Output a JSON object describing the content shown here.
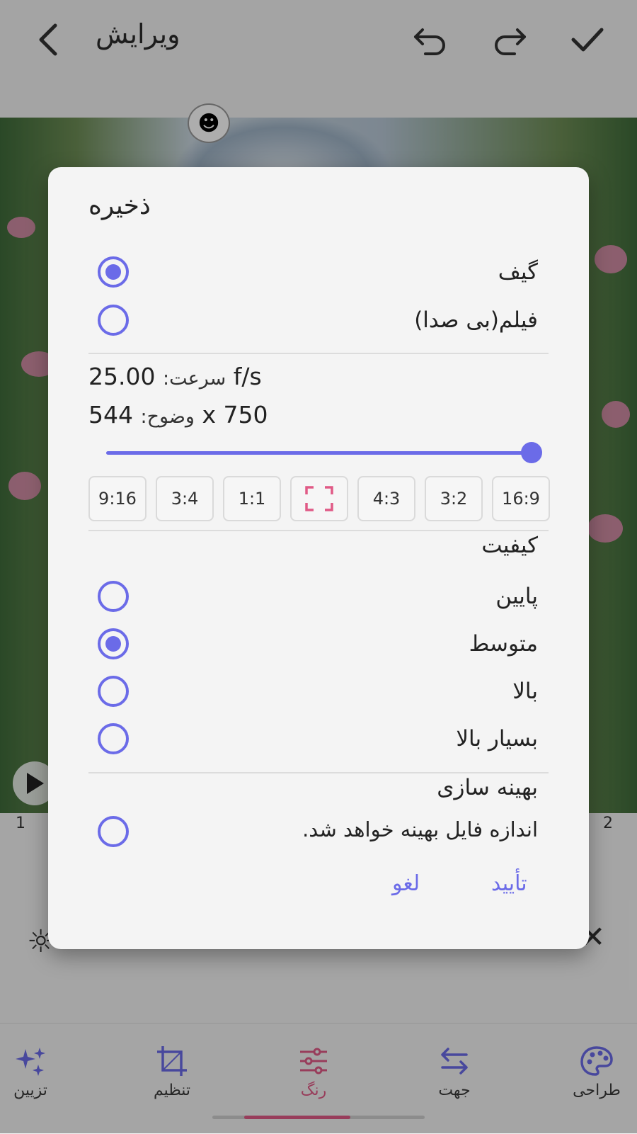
{
  "topbar": {
    "title": "ویرایش"
  },
  "photo": {
    "frame_left": "1",
    "frame_right": "2"
  },
  "bottom_nav": [
    {
      "label": "تزیین",
      "icon": "sparkles-icon"
    },
    {
      "label": "تنظیم",
      "icon": "crop-icon"
    },
    {
      "label": "رنگ",
      "icon": "sliders-icon",
      "active": true
    },
    {
      "label": "جهت",
      "icon": "swap-arrows-icon"
    },
    {
      "label": "طراحی",
      "icon": "palette-icon"
    }
  ],
  "dialog": {
    "title": "ذخیره",
    "format_options": [
      {
        "label": "گیف",
        "selected": true
      },
      {
        "label": "فیلم(بی صدا)",
        "selected": false
      }
    ],
    "speed": {
      "label": "سرعت:",
      "value": "25.00 f/s"
    },
    "resolution": {
      "label": "وضوح:",
      "value": "544 x 750"
    },
    "slider_fraction": 1.0,
    "ratios": [
      "9:16",
      "3:4",
      "1:1",
      "",
      "4:3",
      "3:2",
      "16:9"
    ],
    "quality": {
      "label": "کیفیت",
      "options": [
        {
          "label": "پایین",
          "selected": false
        },
        {
          "label": "متوسط",
          "selected": true
        },
        {
          "label": "بالا",
          "selected": false
        },
        {
          "label": "بسیار بالا",
          "selected": false
        }
      ]
    },
    "optimize": {
      "label": "بهینه سازی",
      "description": "اندازه فایل بهینه خواهد شد.",
      "selected": false
    },
    "cancel_label": "لغو",
    "confirm_label": "تأیید"
  },
  "colors": {
    "accent": "#6b6be8",
    "active_tab": "#e05a86"
  }
}
